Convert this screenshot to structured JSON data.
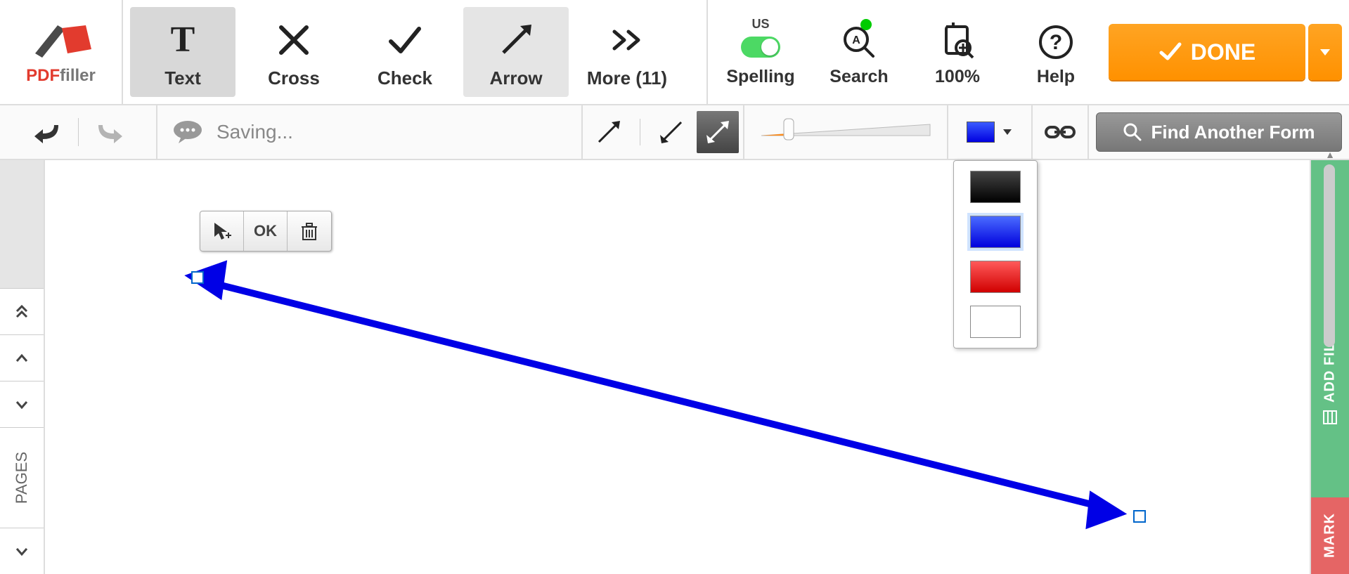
{
  "brand": {
    "pdf": "PDF",
    "filler": "filler"
  },
  "toolbar": {
    "text": {
      "label": "Text"
    },
    "cross": {
      "label": "Cross"
    },
    "check": {
      "label": "Check"
    },
    "arrow": {
      "label": "Arrow"
    },
    "more": {
      "label": "More (11)"
    },
    "spelling": {
      "label": "Spelling",
      "lang": "US"
    },
    "search": {
      "label": "Search"
    },
    "zoom": {
      "label": "100%"
    },
    "help": {
      "label": "Help"
    },
    "done": {
      "label": "DONE"
    }
  },
  "subbar": {
    "status": "Saving...",
    "find_form": "Find Another Form"
  },
  "pages": {
    "label": "PAGES"
  },
  "mini": {
    "ok": "OK"
  },
  "right_tabs": {
    "fillable": "ADD FILLABLE FIELDS",
    "mark": "MARK"
  },
  "colors": {
    "current": "#0000e0",
    "options": [
      "black",
      "blue",
      "red",
      "white"
    ],
    "selected": "blue"
  },
  "arrow_style": {
    "selected": "double-headed"
  }
}
